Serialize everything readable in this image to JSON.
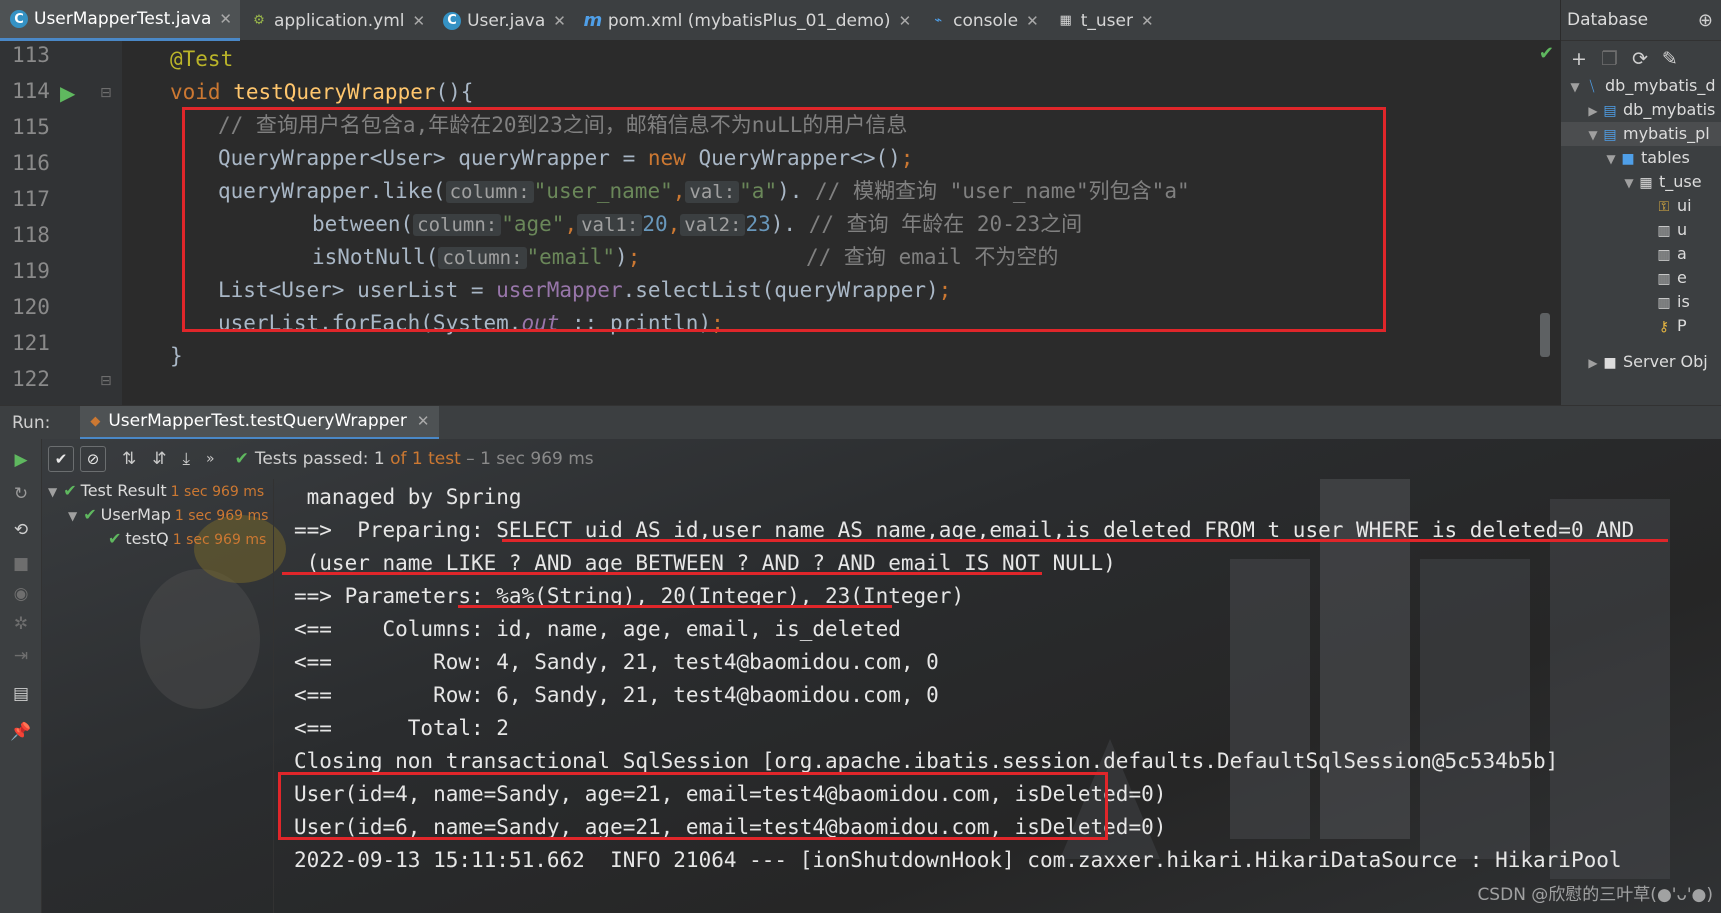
{
  "editor_tabs": [
    {
      "label": "UserMapperTest.java",
      "icon": "java-class-icon",
      "active": true
    },
    {
      "label": "application.yml",
      "icon": "yaml-icon",
      "active": false
    },
    {
      "label": "User.java",
      "icon": "java-class-icon",
      "active": false
    },
    {
      "label": "pom.xml (mybatisPlus_01_demo)",
      "icon": "maven-icon",
      "active": false
    },
    {
      "label": "console",
      "icon": "console-icon",
      "active": false
    },
    {
      "label": "t_user",
      "icon": "table-icon",
      "active": false
    }
  ],
  "line_numbers": [
    "113",
    "114",
    "115",
    "116",
    "117",
    "118",
    "119",
    "120",
    "121",
    "122"
  ],
  "code": {
    "l113_ann": "@Test",
    "l114_kw": "void ",
    "l114_fn": "testQueryWrapper",
    "l114_rest": "(){",
    "l115_cmt": "// 查询用户名包含a,年龄在20到23之间，邮箱信息不为nuLL的用户信息",
    "l116_a": "QueryWrapper<User> queryWrapper = ",
    "l116_kw": "new",
    "l116_b": " QueryWrapper<>()",
    "l116_semi": ";",
    "l117_a": "queryWrapper.like(",
    "l117_hint": "column:",
    "l117_s1": "\"user_name\"",
    "l117_comma": ",",
    "l117_hint2": "val:",
    "l117_s2": "\"a\"",
    "l117_b": "). ",
    "l117_cmt": "// 模糊查询 \"user_name\"列包含\"a\"",
    "l118_a": "between(",
    "l118_hint": "column:",
    "l118_s1": "\"age\"",
    "l118_comma": ",",
    "l118_hint2": "val1:",
    "l118_n1": "20",
    "l118_comma2": ",",
    "l118_hint3": "val2:",
    "l118_n2": "23",
    "l118_b": "). ",
    "l118_cmt": "// 查询 年龄在 20-23之间",
    "l119_a": "isNotNull(",
    "l119_hint": "column:",
    "l119_s1": "\"email\"",
    "l119_b": ")",
    "l119_semi": ";",
    "l119_cmt": "// 查询 email 不为空的",
    "l120_a": "List<User> userList = ",
    "l120_fld": "userMapper",
    "l120_b": ".selectList(queryWrapper)",
    "l120_semi": ";",
    "l121_a": "userList.forEach(System.",
    "l121_fld": "out",
    "l121_b": " :: println)",
    "l121_semi": ";",
    "l122": "}"
  },
  "database_panel": {
    "title": "Database",
    "tree": [
      {
        "label": "db_mybatis_d",
        "depth": 0,
        "expanded": true,
        "icon": "datasource-icon"
      },
      {
        "label": "db_mybatis",
        "depth": 1,
        "expanded": false,
        "icon": "schema-icon"
      },
      {
        "label": "mybatis_pl",
        "depth": 1,
        "expanded": true,
        "icon": "schema-icon",
        "selected": true
      },
      {
        "label": "tables",
        "depth": 2,
        "expanded": true,
        "icon": "folder-icon"
      },
      {
        "label": "t_use",
        "depth": 3,
        "expanded": true,
        "icon": "table-icon"
      },
      {
        "label": "ui",
        "depth": 4,
        "icon": "key-column-icon"
      },
      {
        "label": "u",
        "depth": 4,
        "icon": "column-icon"
      },
      {
        "label": "a",
        "depth": 4,
        "icon": "column-icon"
      },
      {
        "label": "e",
        "depth": 4,
        "icon": "column-icon"
      },
      {
        "label": "is",
        "depth": 4,
        "icon": "column-icon"
      },
      {
        "label": "P",
        "depth": 4,
        "icon": "primary-key-icon"
      },
      {
        "label": "Server Obj",
        "depth": 1,
        "expanded": false,
        "icon": "folder-icon"
      }
    ]
  },
  "run_panel": {
    "label": "Run:",
    "tab": "UserMapperTest.testQueryWrapper",
    "status": {
      "prefix": "Tests passed: ",
      "count": "1",
      "of": " of 1 test",
      "duration": " – 1 sec 969 ms"
    },
    "tree": [
      {
        "label": "Test Result",
        "time": "1 sec 969 ms"
      },
      {
        "label": "UserMap",
        "time": "1 sec 969 ms"
      },
      {
        "label": "testQ",
        "time": "1 sec 969 ms"
      }
    ]
  },
  "console_lines": [
    " managed by Spring",
    "==>  Preparing: SELECT uid AS id,user_name AS name,age,email,is_deleted FROM t_user WHERE is_deleted=0 AND",
    " (user_name LIKE ? AND age BETWEEN ? AND ? AND email IS NOT NULL)",
    "==> Parameters: %a%(String), 20(Integer), 23(Integer)",
    "<==    Columns: id, name, age, email, is_deleted",
    "<==        Row: 4, Sandy, 21, test4@baomidou.com, 0",
    "<==        Row: 6, Sandy, 21, test4@baomidou.com, 0",
    "<==      Total: 2",
    "Closing non transactional SqlSession [org.apache.ibatis.session.defaults.DefaultSqlSession@5c534b5b]",
    "User(id=4, name=Sandy, age=21, email=test4@baomidou.com, isDeleted=0)",
    "User(id=6, name=Sandy, age=21, email=test4@baomidou.com, isDeleted=0)",
    "2022-09-13 15:11:51.662  INFO 21064 --- [ionShutdownHook] com.zaxxer.hikari.HikariDataSource : HikariPool"
  ],
  "watermark": "CSDN @欣慰的三叶草(●'ᴗ'●)",
  "colors": {
    "highlight_red": "#e0262a",
    "accent_blue": "#4a88c7",
    "pass_green": "#5fb85f"
  }
}
